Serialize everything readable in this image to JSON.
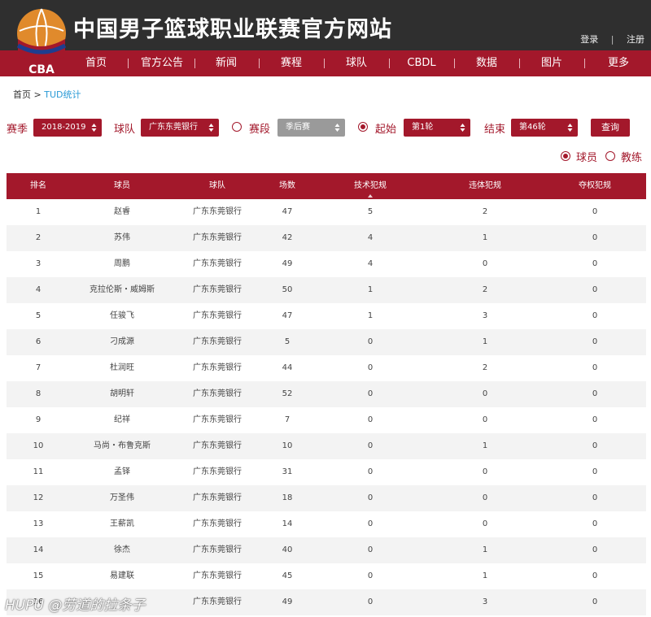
{
  "header": {
    "site_title": "中国男子篮球职业联赛官方网站",
    "login": "登录",
    "register": "注册",
    "divider": "|",
    "logo_text": "CBA"
  },
  "nav": {
    "items": [
      "首页",
      "官方公告",
      "新闻",
      "赛程",
      "球队",
      "CBDL",
      "数据",
      "图片",
      "更多"
    ]
  },
  "breadcrumb": {
    "home": "首页",
    "separator": ">",
    "current": "TUD统计"
  },
  "filters": {
    "season_label": "赛季",
    "season_value": "2018-2019",
    "team_label": "球队",
    "team_value": "广东东莞银行",
    "stage_label": "赛段",
    "stage_value": "季后赛",
    "start_label": "起始",
    "start_value": "第1轮",
    "end_label": "结束",
    "end_value": "第46轮",
    "query_button": "查询",
    "player_label": "球员",
    "coach_label": "教练"
  },
  "table": {
    "headers": [
      "排名",
      "球员",
      "球队",
      "场数",
      "技术犯规",
      "违体犯规",
      "夺权犯规"
    ],
    "rows": [
      [
        "1",
        "赵睿",
        "广东东莞银行",
        "47",
        "5",
        "2",
        "0"
      ],
      [
        "2",
        "苏伟",
        "广东东莞银行",
        "42",
        "4",
        "1",
        "0"
      ],
      [
        "3",
        "周鹏",
        "广东东莞银行",
        "49",
        "4",
        "0",
        "0"
      ],
      [
        "4",
        "克拉伦斯・威姆斯",
        "广东东莞银行",
        "50",
        "1",
        "2",
        "0"
      ],
      [
        "5",
        "任骏飞",
        "广东东莞银行",
        "47",
        "1",
        "3",
        "0"
      ],
      [
        "6",
        "刁成源",
        "广东东莞银行",
        "5",
        "0",
        "1",
        "0"
      ],
      [
        "7",
        "杜润旺",
        "广东东莞银行",
        "44",
        "0",
        "2",
        "0"
      ],
      [
        "8",
        "胡明轩",
        "广东东莞银行",
        "52",
        "0",
        "0",
        "0"
      ],
      [
        "9",
        "纪祥",
        "广东东莞银行",
        "7",
        "0",
        "0",
        "0"
      ],
      [
        "10",
        "马尚・布鲁克斯",
        "广东东莞银行",
        "10",
        "0",
        "1",
        "0"
      ],
      [
        "11",
        "孟铎",
        "广东东莞银行",
        "31",
        "0",
        "0",
        "0"
      ],
      [
        "12",
        "万圣伟",
        "广东东莞银行",
        "18",
        "0",
        "0",
        "0"
      ],
      [
        "13",
        "王薪凯",
        "广东东莞银行",
        "14",
        "0",
        "0",
        "0"
      ],
      [
        "14",
        "徐杰",
        "广东东莞银行",
        "40",
        "0",
        "1",
        "0"
      ],
      [
        "15",
        "易建联",
        "广东东莞银行",
        "45",
        "0",
        "1",
        "0"
      ],
      [
        "16",
        "",
        "广东东莞银行",
        "49",
        "0",
        "3",
        "0"
      ]
    ]
  },
  "watermark": "HUPU @劳道的拉条子",
  "colors": {
    "brand_red": "#a3182b",
    "header_dark": "#2f2f2f",
    "link_blue": "#2a9ad6",
    "stripe": "#f3f3f3"
  }
}
